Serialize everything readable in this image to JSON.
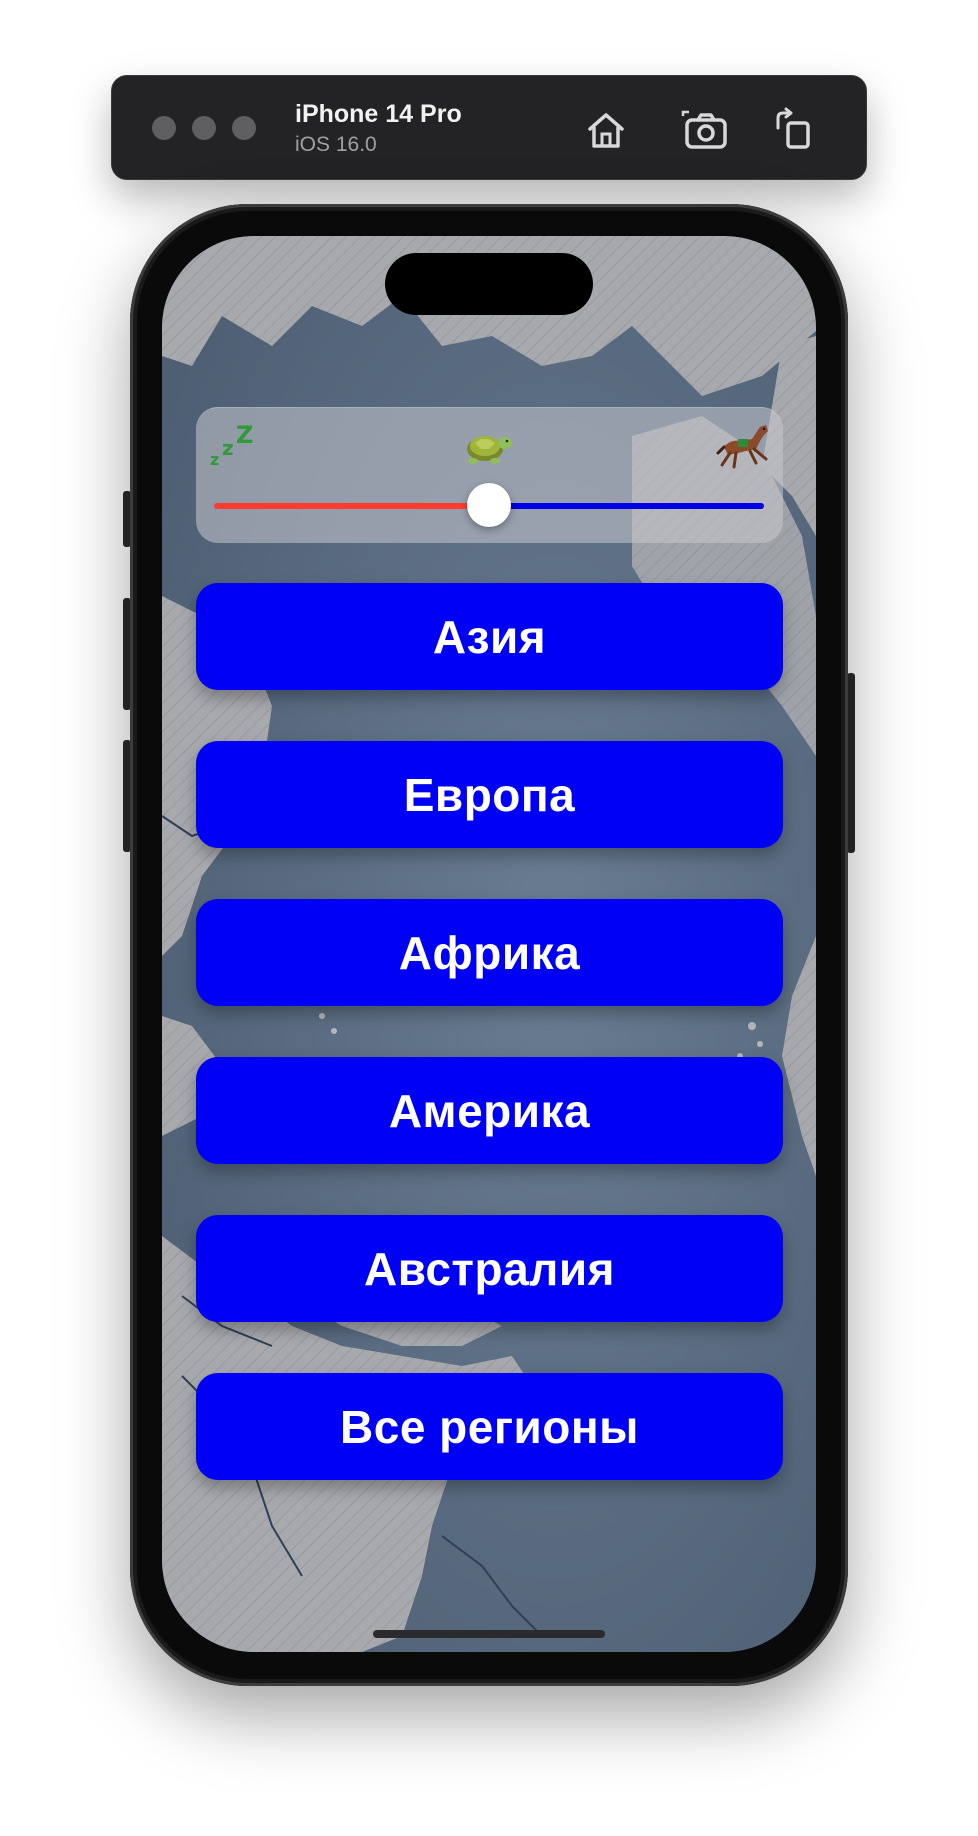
{
  "simulator": {
    "device_name": "iPhone 14 Pro",
    "os_version": "iOS 16.0",
    "toolbar_icons": [
      "home-icon",
      "screenshot-icon",
      "rotate-icon"
    ]
  },
  "speed_control": {
    "left_icon": "sleep-zzz-icon",
    "middle_icon": "turtle-icon",
    "right_icon": "horse-icon",
    "slider_value": 0.5,
    "min_track_color": "#ff3b30",
    "max_track_color": "#0000e6"
  },
  "regions": [
    {
      "label": "Азия"
    },
    {
      "label": "Европа"
    },
    {
      "label": "Африка"
    },
    {
      "label": "Америка"
    },
    {
      "label": "Австралия"
    },
    {
      "label": "Все регионы"
    }
  ],
  "colors": {
    "button_background": "#0000f5",
    "button_text": "#ffffff"
  }
}
